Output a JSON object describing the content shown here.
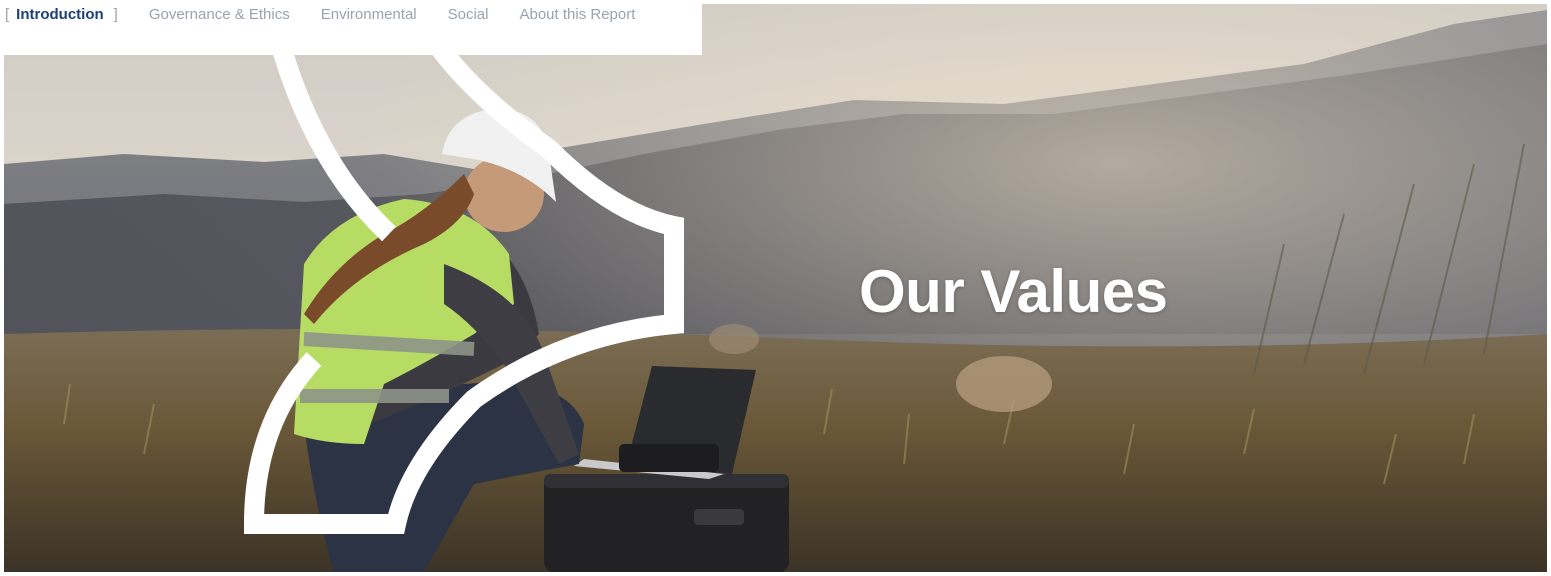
{
  "nav": {
    "items": [
      {
        "label": "Introduction",
        "active": true
      },
      {
        "label": "Governance & Ethics",
        "active": false
      },
      {
        "label": "Environmental",
        "active": false
      },
      {
        "label": "Social",
        "active": false
      },
      {
        "label": "About this Report",
        "active": false
      }
    ],
    "bracket_open": "[",
    "bracket_close": "]",
    "active_color": "#1b3f7a",
    "inactive_color": "#9aa3ad"
  },
  "hero": {
    "title": "Our Values",
    "image": "photo of a construction worker in a hard hat and hi-vis vest kneeling beside a laptop on an equipment case in a grassy hillside field"
  },
  "colors": {
    "sky": "#dcd6ce",
    "mountain": "#6f7277",
    "field": "#6b5a3e",
    "vest": "#b9de6a",
    "helmet": "#f1f1f1",
    "accent_shape": "#ffffff"
  }
}
